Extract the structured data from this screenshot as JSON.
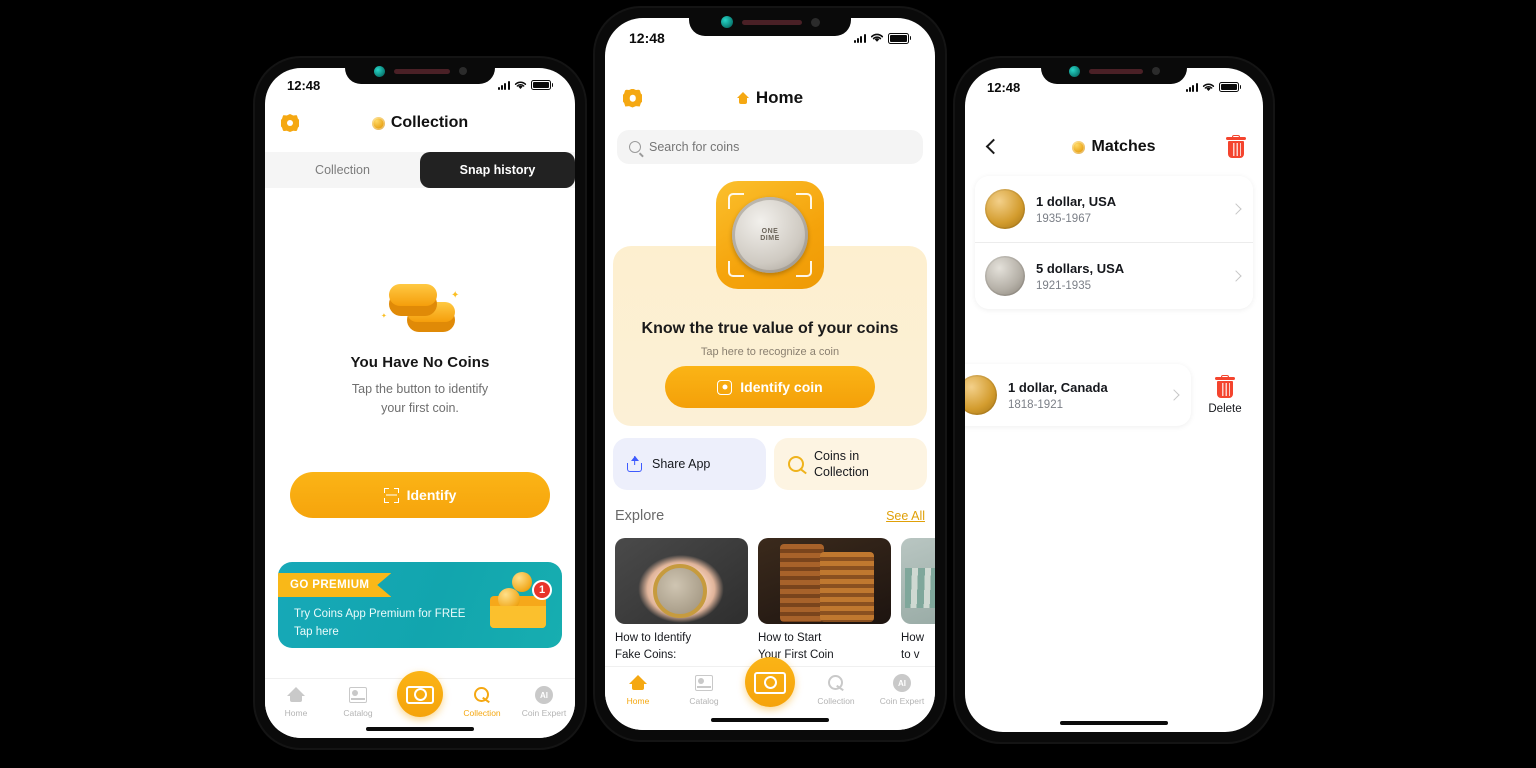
{
  "app": {
    "accent": "#F5A812",
    "teal": "#17A9B8",
    "danger": "#F4442E",
    "dark": "#222222"
  },
  "status_bar": {
    "time": "12:48"
  },
  "phone1": {
    "header": {
      "settings_icon": "gear-icon",
      "title_icon": "coin-icon",
      "title": "Collection"
    },
    "segmented": {
      "options": [
        "Collection",
        "Snap history"
      ],
      "selected": "Snap history"
    },
    "empty_state": {
      "illustration": "stacked-coins-illustration",
      "title": "You Have No Coins",
      "description_line1": "Tap the button to identify",
      "description_line2": "your first coin."
    },
    "identify_button": {
      "icon": "scan-icon",
      "label": "Identify"
    },
    "premium_banner": {
      "ribbon": "GO PREMIUM",
      "line1": "Try Coins App Premium for FREE",
      "line2": "Tap here",
      "badge_count": "1",
      "art": "envelope-with-coins-illustration"
    },
    "tabbar": {
      "items": [
        {
          "label": "Home",
          "icon": "home-icon",
          "active": false
        },
        {
          "label": "Catalog",
          "icon": "book-icon",
          "active": false
        },
        {
          "label": "Collection",
          "icon": "coin-icon",
          "active": true
        },
        {
          "label": "Coin Expert",
          "icon": "ai-icon",
          "active": false
        }
      ],
      "camera_button": "camera-icon"
    }
  },
  "phone2": {
    "header": {
      "settings_icon": "gear-icon",
      "title_icon": "home-icon",
      "title": "Home"
    },
    "search": {
      "icon": "search-icon",
      "placeholder": "Search for coins",
      "value": ""
    },
    "hero": {
      "scan_frame": "scan-frame",
      "coin_label_top": "ONE",
      "coin_label_bottom": "DIME",
      "title": "Know the true value of your coins",
      "subtitle": "Tap here to recognize a coin",
      "button_icon": "scan-focus-icon",
      "button_label": "Identify coin"
    },
    "quick_actions": [
      {
        "label": "Share App",
        "icon": "share-icon"
      },
      {
        "label": "Coins in Collection",
        "icon": "coin-icon"
      }
    ],
    "explore": {
      "heading": "Explore",
      "see_all": "See All"
    },
    "explore_cards": [
      {
        "title": "How to Identify Fake Coins:",
        "thumb": "hand-holding-magnifier-coins"
      },
      {
        "title": "How to Start Your First Coin",
        "thumb": "stacks-of-copper-coins"
      },
      {
        "title": "How to v",
        "thumb": "banknotes-and-coins"
      }
    ],
    "tabbar": {
      "items": [
        {
          "label": "Home",
          "icon": "home-icon",
          "active": true
        },
        {
          "label": "Catalog",
          "icon": "book-icon",
          "active": false
        },
        {
          "label": "Collection",
          "icon": "coin-icon",
          "active": false
        },
        {
          "label": "Coin Expert",
          "icon": "ai-icon",
          "active": false
        }
      ],
      "camera_button": "camera-icon"
    }
  },
  "phone3": {
    "header": {
      "back_icon": "chevron-left-icon",
      "title_icon": "coin-icon",
      "title": "Matches",
      "delete_icon": "trash-icon"
    },
    "matches": [
      {
        "name": "1 dollar, USA",
        "years": "1935-1967",
        "thumb": "gold-coin"
      },
      {
        "name": "5 dollars, USA",
        "years": "1921-1935",
        "thumb": "silver-coin"
      }
    ],
    "swiped_row": {
      "name": "1 dollar, Canada",
      "years": "1818-1921",
      "thumb": "gold-coin",
      "action_icon": "trash-icon",
      "action_label": "Delete"
    }
  }
}
